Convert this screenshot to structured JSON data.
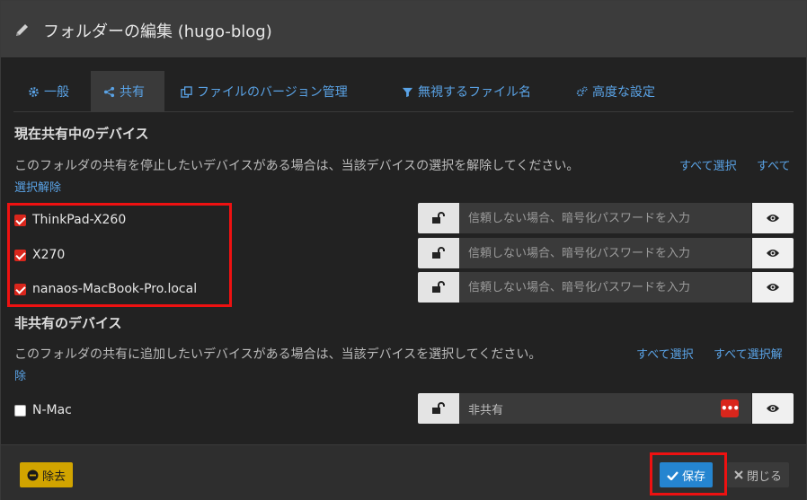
{
  "header": {
    "title": "フォルダーの編集 (hugo-blog)"
  },
  "tabs": [
    {
      "label": "一般",
      "icon": "gear-icon"
    },
    {
      "label": "共有",
      "icon": "share-icon"
    },
    {
      "label": "ファイルのバージョン管理",
      "icon": "copy-icon"
    },
    {
      "label": "無視するファイル名",
      "icon": "filter-icon"
    },
    {
      "label": "高度な設定",
      "icon": "gears-icon"
    }
  ],
  "shared": {
    "title": "現在共有中のデバイス",
    "help": "このフォルダの共有を停止したいデバイスがある場合は、当該デバイスの選択を解除してください。",
    "select_all": "すべて選択",
    "deselect_all_a": "すべて",
    "deselect_all_b": "選択解除",
    "devices": [
      {
        "name": "ThinkPad-X260",
        "checked": true,
        "placeholder": "信頼しない場合、暗号化パスワードを入力"
      },
      {
        "name": "X270",
        "checked": true,
        "placeholder": "信頼しない場合、暗号化パスワードを入力"
      },
      {
        "name": "nanaos-MacBook-Pro.local",
        "checked": true,
        "placeholder": "信頼しない場合、暗号化パスワードを入力"
      }
    ]
  },
  "unshared": {
    "title": "非共有のデバイス",
    "help": "このフォルダの共有に追加したいデバイスがある場合は、当該デバイスを選択してください。",
    "select_all": "すべて選択",
    "deselect_all_a": "すべて選択解",
    "deselect_all_b": "除",
    "devices": [
      {
        "name": "N-Mac",
        "checked": false,
        "value": "非共有"
      }
    ]
  },
  "footer": {
    "remove_label": "除去",
    "save_label": "保存",
    "close_label": "閉じる"
  },
  "colors": {
    "accent": "#2585d0",
    "link": "#5aa3e6",
    "highlight": "#ee1111",
    "warning": "#d1a400"
  }
}
